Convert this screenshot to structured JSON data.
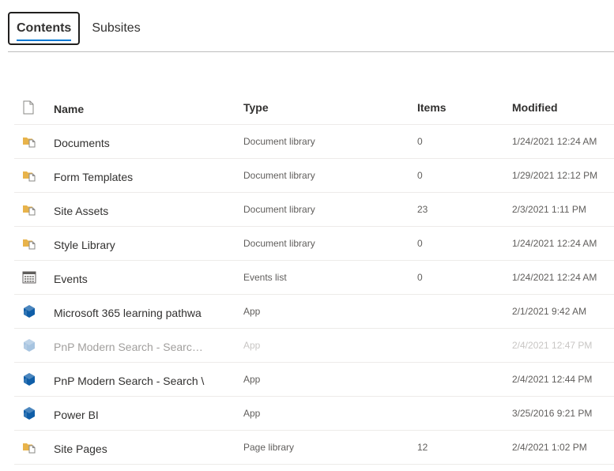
{
  "tabs": [
    {
      "label": "Contents",
      "active": true
    },
    {
      "label": "Subsites",
      "active": false
    }
  ],
  "columns": {
    "name": "Name",
    "type": "Type",
    "items": "Items",
    "modified": "Modified"
  },
  "rows": [
    {
      "icon": "library-icon",
      "name": "Documents",
      "type": "Document library",
      "items": "0",
      "modified": "1/24/2021 12:24 AM"
    },
    {
      "icon": "library-icon",
      "name": "Form Templates",
      "type": "Document library",
      "items": "0",
      "modified": "1/29/2021 12:12 PM"
    },
    {
      "icon": "library-icon",
      "name": "Site Assets",
      "type": "Document library",
      "items": "23",
      "modified": "2/3/2021 1:11 PM"
    },
    {
      "icon": "library-icon",
      "name": "Style Library",
      "type": "Document library",
      "items": "0",
      "modified": "1/24/2021 12:24 AM"
    },
    {
      "icon": "calendar-icon",
      "name": "Events",
      "type": "Events list",
      "items": "0",
      "modified": "1/24/2021 12:24 AM"
    },
    {
      "icon": "app-icon",
      "name": "Microsoft 365 learning pathwa",
      "type": "App",
      "items": "",
      "modified": "2/1/2021 9:42 AM"
    },
    {
      "icon": "app-icon",
      "name": "PnP Modern Search - Searc…",
      "type": "App",
      "items": "",
      "modified": "2/4/2021 12:47 PM"
    },
    {
      "icon": "app-icon",
      "name": "PnP Modern Search - Search \\",
      "type": "App",
      "items": "",
      "modified": "2/4/2021 12:44 PM"
    },
    {
      "icon": "app-icon",
      "name": "Power BI",
      "type": "App",
      "items": "",
      "modified": "3/25/2016 9:21 PM"
    },
    {
      "icon": "library-icon",
      "name": "Site Pages",
      "type": "Page library",
      "items": "12",
      "modified": "2/4/2021 1:02 PM"
    }
  ],
  "colors": {
    "folder": "#e8b34a",
    "app": "#0f5ea8",
    "app_dim": "#a7c4e0",
    "accent": "#0078d4"
  }
}
